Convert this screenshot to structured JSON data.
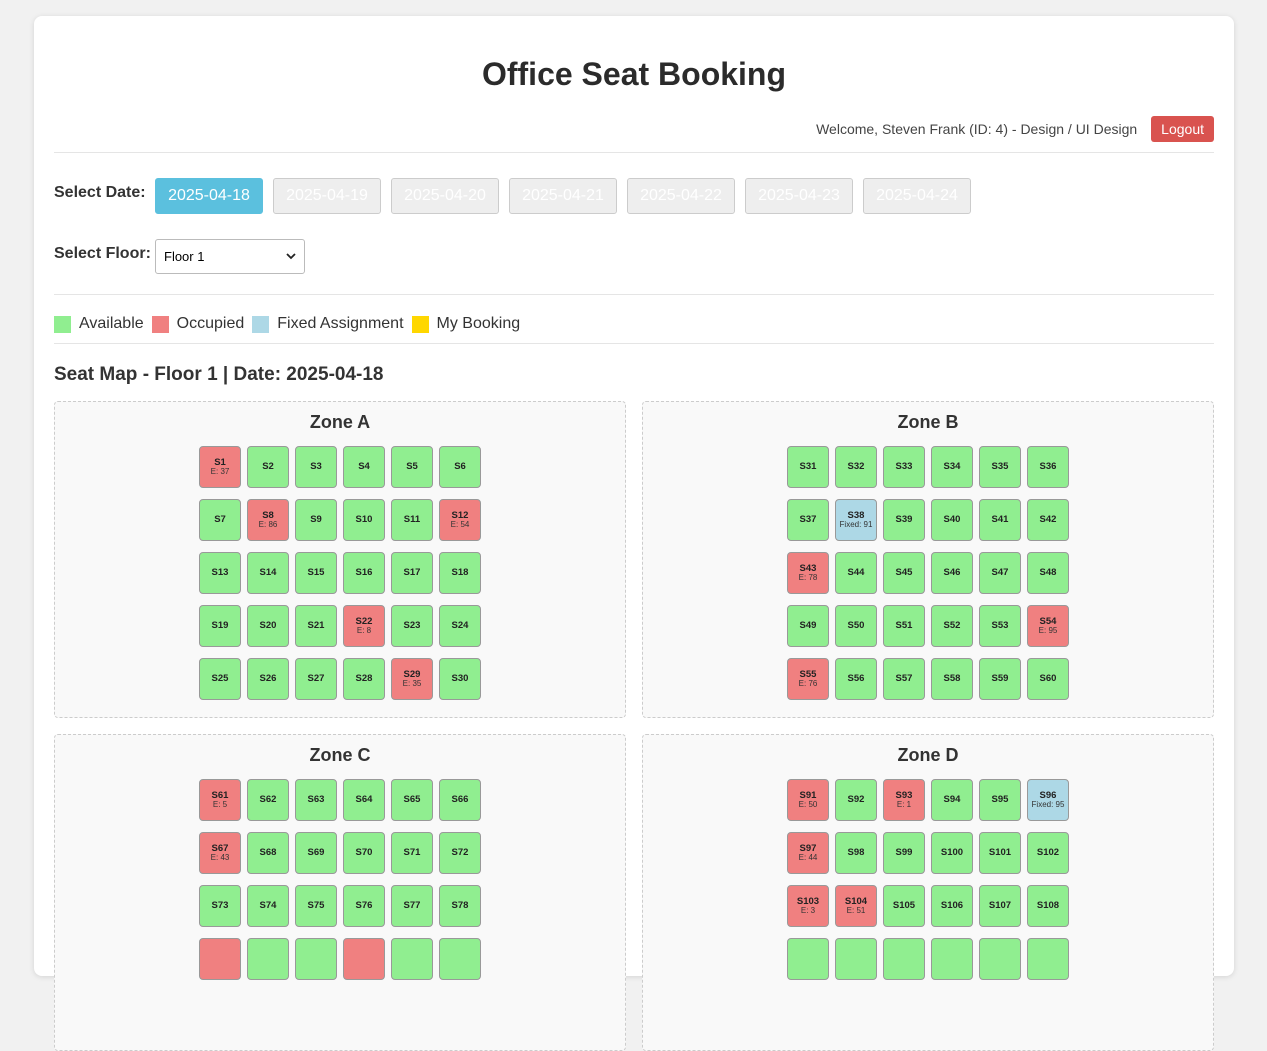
{
  "app": {
    "title": "Office Seat Booking"
  },
  "user": {
    "welcome": "Welcome, Steven Frank (ID: 4) - Design / UI Design",
    "logout_label": "Logout"
  },
  "date_select": {
    "label": "Select Date:",
    "dates": [
      "2025-04-18",
      "2025-04-19",
      "2025-04-20",
      "2025-04-21",
      "2025-04-22",
      "2025-04-23",
      "2025-04-24"
    ],
    "selected_index": 0
  },
  "floor_select": {
    "label": "Select Floor:",
    "value": "Floor 1"
  },
  "legend": [
    {
      "label": "Available",
      "color": "#90ee90"
    },
    {
      "label": "Occupied",
      "color": "#f08080"
    },
    {
      "label": "Fixed Assignment",
      "color": "#add8e6"
    },
    {
      "label": "My Booking",
      "color": "#ffd700"
    }
  ],
  "seat_map_title": "Seat Map - Floor 1 | Date: 2025-04-18",
  "zones": [
    {
      "name": "Zone A",
      "seats": [
        {
          "id": "S1",
          "status": "occupied",
          "sub": "E: 37"
        },
        {
          "id": "S2",
          "status": "available"
        },
        {
          "id": "S3",
          "status": "available"
        },
        {
          "id": "S4",
          "status": "available"
        },
        {
          "id": "S5",
          "status": "available"
        },
        {
          "id": "S6",
          "status": "available"
        },
        {
          "id": "S7",
          "status": "available"
        },
        {
          "id": "S8",
          "status": "occupied",
          "sub": "E: 86"
        },
        {
          "id": "S9",
          "status": "available"
        },
        {
          "id": "S10",
          "status": "available"
        },
        {
          "id": "S11",
          "status": "available"
        },
        {
          "id": "S12",
          "status": "occupied",
          "sub": "E: 54"
        },
        {
          "id": "S13",
          "status": "available"
        },
        {
          "id": "S14",
          "status": "available"
        },
        {
          "id": "S15",
          "status": "available"
        },
        {
          "id": "S16",
          "status": "available"
        },
        {
          "id": "S17",
          "status": "available"
        },
        {
          "id": "S18",
          "status": "available"
        },
        {
          "id": "S19",
          "status": "available"
        },
        {
          "id": "S20",
          "status": "available"
        },
        {
          "id": "S21",
          "status": "available"
        },
        {
          "id": "S22",
          "status": "occupied",
          "sub": "E: 8"
        },
        {
          "id": "S23",
          "status": "available"
        },
        {
          "id": "S24",
          "status": "available"
        },
        {
          "id": "S25",
          "status": "available"
        },
        {
          "id": "S26",
          "status": "available"
        },
        {
          "id": "S27",
          "status": "available"
        },
        {
          "id": "S28",
          "status": "available"
        },
        {
          "id": "S29",
          "status": "occupied",
          "sub": "E: 35"
        },
        {
          "id": "S30",
          "status": "available"
        }
      ]
    },
    {
      "name": "Zone B",
      "seats": [
        {
          "id": "S31",
          "status": "available"
        },
        {
          "id": "S32",
          "status": "available"
        },
        {
          "id": "S33",
          "status": "available"
        },
        {
          "id": "S34",
          "status": "available"
        },
        {
          "id": "S35",
          "status": "available"
        },
        {
          "id": "S36",
          "status": "available"
        },
        {
          "id": "S37",
          "status": "available"
        },
        {
          "id": "S38",
          "status": "fixed",
          "sub": "Fixed: 91"
        },
        {
          "id": "S39",
          "status": "available"
        },
        {
          "id": "S40",
          "status": "available"
        },
        {
          "id": "S41",
          "status": "available"
        },
        {
          "id": "S42",
          "status": "available"
        },
        {
          "id": "S43",
          "status": "occupied",
          "sub": "E: 78"
        },
        {
          "id": "S44",
          "status": "available"
        },
        {
          "id": "S45",
          "status": "available"
        },
        {
          "id": "S46",
          "status": "available"
        },
        {
          "id": "S47",
          "status": "available"
        },
        {
          "id": "S48",
          "status": "available"
        },
        {
          "id": "S49",
          "status": "available"
        },
        {
          "id": "S50",
          "status": "available"
        },
        {
          "id": "S51",
          "status": "available"
        },
        {
          "id": "S52",
          "status": "available"
        },
        {
          "id": "S53",
          "status": "available"
        },
        {
          "id": "S54",
          "status": "occupied",
          "sub": "E: 95"
        },
        {
          "id": "S55",
          "status": "occupied",
          "sub": "E: 76"
        },
        {
          "id": "S56",
          "status": "available"
        },
        {
          "id": "S57",
          "status": "available"
        },
        {
          "id": "S58",
          "status": "available"
        },
        {
          "id": "S59",
          "status": "available"
        },
        {
          "id": "S60",
          "status": "available"
        }
      ]
    },
    {
      "name": "Zone C",
      "seats": [
        {
          "id": "S61",
          "status": "occupied",
          "sub": "E: 5"
        },
        {
          "id": "S62",
          "status": "available"
        },
        {
          "id": "S63",
          "status": "available"
        },
        {
          "id": "S64",
          "status": "available"
        },
        {
          "id": "S65",
          "status": "available"
        },
        {
          "id": "S66",
          "status": "available"
        },
        {
          "id": "S67",
          "status": "occupied",
          "sub": "E: 43"
        },
        {
          "id": "S68",
          "status": "available"
        },
        {
          "id": "S69",
          "status": "available"
        },
        {
          "id": "S70",
          "status": "available"
        },
        {
          "id": "S71",
          "status": "available"
        },
        {
          "id": "S72",
          "status": "available"
        },
        {
          "id": "S73",
          "status": "available"
        },
        {
          "id": "S74",
          "status": "available"
        },
        {
          "id": "S75",
          "status": "available"
        },
        {
          "id": "S76",
          "status": "available"
        },
        {
          "id": "S77",
          "status": "available"
        },
        {
          "id": "S78",
          "status": "available"
        },
        {
          "id": "",
          "status": "occupied"
        },
        {
          "id": "",
          "status": "available"
        },
        {
          "id": "",
          "status": "available"
        },
        {
          "id": "",
          "status": "occupied"
        },
        {
          "id": "",
          "status": "available"
        },
        {
          "id": "",
          "status": "available"
        }
      ]
    },
    {
      "name": "Zone D",
      "seats": [
        {
          "id": "S91",
          "status": "occupied",
          "sub": "E: 50"
        },
        {
          "id": "S92",
          "status": "available"
        },
        {
          "id": "S93",
          "status": "occupied",
          "sub": "E: 1"
        },
        {
          "id": "S94",
          "status": "available"
        },
        {
          "id": "S95",
          "status": "available"
        },
        {
          "id": "S96",
          "status": "fixed",
          "sub": "Fixed: 95"
        },
        {
          "id": "S97",
          "status": "occupied",
          "sub": "E: 44"
        },
        {
          "id": "S98",
          "status": "available"
        },
        {
          "id": "S99",
          "status": "available"
        },
        {
          "id": "S100",
          "status": "available"
        },
        {
          "id": "S101",
          "status": "available"
        },
        {
          "id": "S102",
          "status": "available"
        },
        {
          "id": "S103",
          "status": "occupied",
          "sub": "E: 3"
        },
        {
          "id": "S104",
          "status": "occupied",
          "sub": "E: 51"
        },
        {
          "id": "S105",
          "status": "available"
        },
        {
          "id": "S106",
          "status": "available"
        },
        {
          "id": "S107",
          "status": "available"
        },
        {
          "id": "S108",
          "status": "available"
        },
        {
          "id": "",
          "status": "available"
        },
        {
          "id": "",
          "status": "available"
        },
        {
          "id": "",
          "status": "available"
        },
        {
          "id": "",
          "status": "available"
        },
        {
          "id": "",
          "status": "available"
        },
        {
          "id": "",
          "status": "available"
        }
      ]
    }
  ]
}
